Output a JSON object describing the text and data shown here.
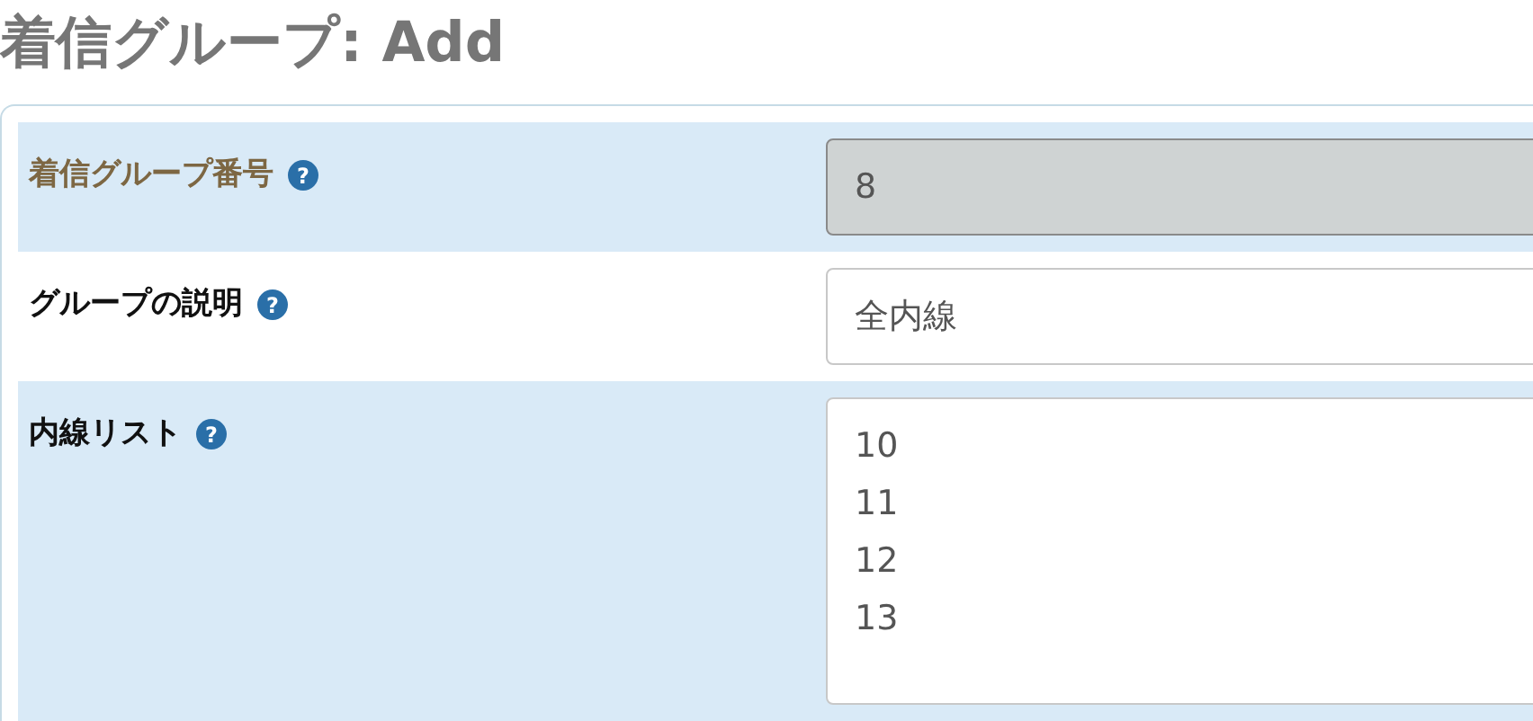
{
  "page_title": "着信グループ: Add",
  "fields": [
    {
      "label": "着信グループ番号",
      "help_icon": "?",
      "kind": "input",
      "value": "8",
      "disabled": true
    },
    {
      "label": "グループの説明",
      "help_icon": "?",
      "kind": "input",
      "value": "全内線",
      "disabled": false
    },
    {
      "label": "内線リスト",
      "help_icon": "?",
      "kind": "textarea",
      "value": "10\n11\n12\n13",
      "disabled": false
    }
  ]
}
